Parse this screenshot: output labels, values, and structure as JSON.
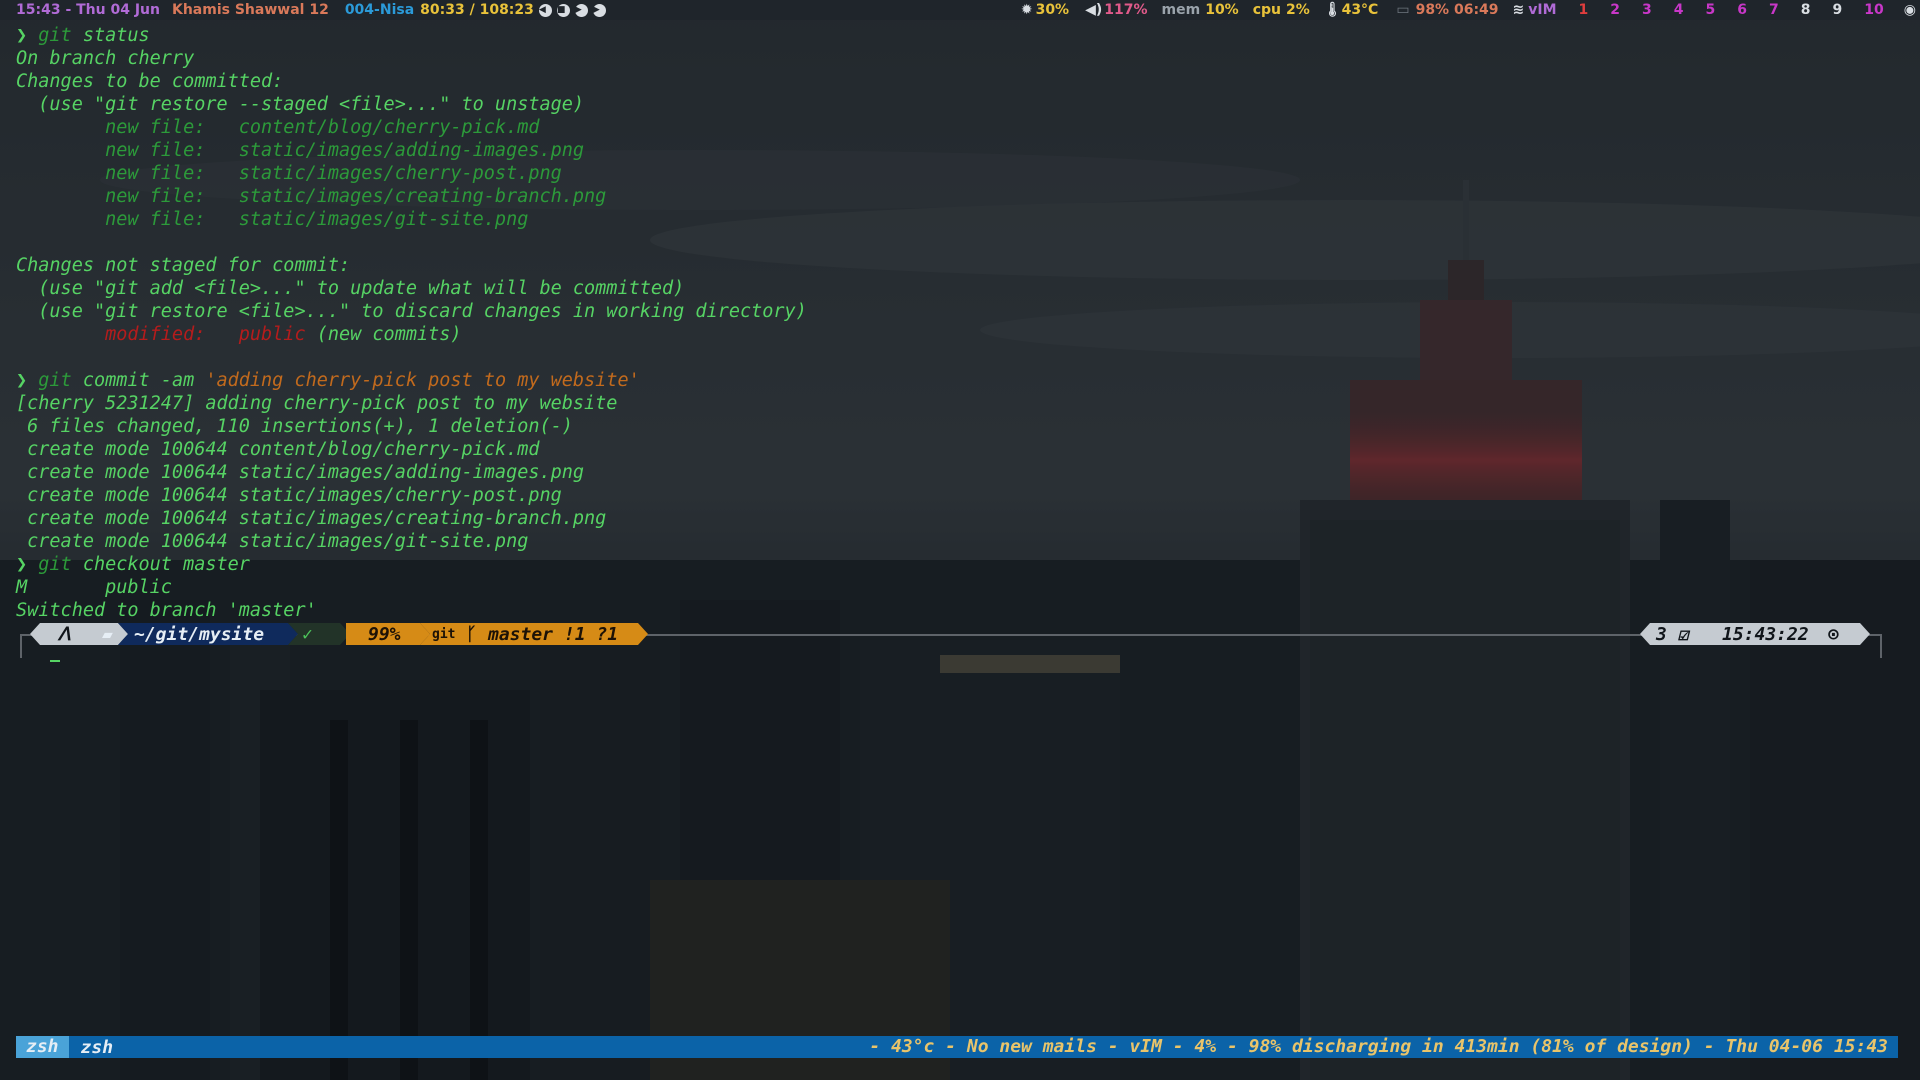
{
  "topbar": {
    "clock": "15:43 - Thu 04 Jun",
    "hijri": "Khamis Shawwal 12",
    "track": "004-Nisa",
    "progress": "80:33 / 108:23",
    "brightness": "30%",
    "volume": "117%",
    "mem_label": "mem",
    "mem_value": "10%",
    "cpu_label": "cpu",
    "cpu_value": "2%",
    "temp": "43°C",
    "battery": "98% 06:49",
    "wifi": "vIM",
    "workspaces": [
      "1",
      "2",
      "3",
      "4",
      "5",
      "6",
      "7",
      "8",
      "9",
      "10"
    ],
    "workspace_colors": [
      "#e03d3d",
      "#c837c8",
      "#c837c8",
      "#c837c8",
      "#c837c8",
      "#c837c8",
      "#c837c8",
      "#d8dde2",
      "#d8dde2",
      "#c837c8"
    ]
  },
  "terminal": {
    "prompt_symbol": "❯",
    "lines": [
      {
        "parts": [
          {
            "t": "❯ ",
            "c": "sym"
          },
          {
            "t": "git",
            "c": "dim"
          },
          {
            "t": " status",
            "c": ""
          }
        ]
      },
      {
        "parts": [
          {
            "t": "On branch cherry",
            "c": ""
          }
        ]
      },
      {
        "parts": [
          {
            "t": "Changes to be committed:",
            "c": ""
          }
        ]
      },
      {
        "parts": [
          {
            "t": "  (use \"git restore --staged <file>...\" to unstage)",
            "c": ""
          }
        ]
      },
      {
        "parts": [
          {
            "t": "        new file:   content/blog/cherry-pick.md",
            "c": "dim"
          }
        ]
      },
      {
        "parts": [
          {
            "t": "        new file:   static/images/adding-images.png",
            "c": "dim"
          }
        ]
      },
      {
        "parts": [
          {
            "t": "        new file:   static/images/cherry-post.png",
            "c": "dim"
          }
        ]
      },
      {
        "parts": [
          {
            "t": "        new file:   static/images/creating-branch.png",
            "c": "dim"
          }
        ]
      },
      {
        "parts": [
          {
            "t": "        new file:   static/images/git-site.png",
            "c": "dim"
          }
        ]
      },
      {
        "parts": [
          {
            "t": "",
            "c": ""
          }
        ]
      },
      {
        "parts": [
          {
            "t": "Changes not staged for commit:",
            "c": ""
          }
        ]
      },
      {
        "parts": [
          {
            "t": "  (use \"git add <file>...\" to update what will be committed)",
            "c": ""
          }
        ]
      },
      {
        "parts": [
          {
            "t": "  (use \"git restore <file>...\" to discard changes in working directory)",
            "c": ""
          }
        ]
      },
      {
        "parts": [
          {
            "t": "        modified:   public",
            "c": "red"
          },
          {
            "t": " (new commits)",
            "c": ""
          }
        ]
      },
      {
        "parts": [
          {
            "t": "",
            "c": ""
          }
        ]
      },
      {
        "parts": [
          {
            "t": "❯ ",
            "c": "sym"
          },
          {
            "t": "git",
            "c": "dim"
          },
          {
            "t": " commit -am ",
            "c": ""
          },
          {
            "t": "'adding cherry-pick post to my website'",
            "c": "orange"
          }
        ]
      },
      {
        "parts": [
          {
            "t": "[cherry 5231247] adding cherry-pick post to my website",
            "c": ""
          }
        ]
      },
      {
        "parts": [
          {
            "t": " 6 files changed, 110 insertions(+), 1 deletion(-)",
            "c": ""
          }
        ]
      },
      {
        "parts": [
          {
            "t": " create mode 100644 content/blog/cherry-pick.md",
            "c": ""
          }
        ]
      },
      {
        "parts": [
          {
            "t": " create mode 100644 static/images/adding-images.png",
            "c": ""
          }
        ]
      },
      {
        "parts": [
          {
            "t": " create mode 100644 static/images/cherry-post.png",
            "c": ""
          }
        ]
      },
      {
        "parts": [
          {
            "t": " create mode 100644 static/images/creating-branch.png",
            "c": ""
          }
        ]
      },
      {
        "parts": [
          {
            "t": " create mode 100644 static/images/git-site.png",
            "c": ""
          }
        ]
      },
      {
        "parts": [
          {
            "t": "❯ ",
            "c": "sym"
          },
          {
            "t": "git",
            "c": "dim"
          },
          {
            "t": " checkout master",
            "c": ""
          }
        ]
      },
      {
        "parts": [
          {
            "t": "M       public",
            "c": ""
          }
        ]
      },
      {
        "parts": [
          {
            "t": "Switched to branch 'master'",
            "c": ""
          }
        ]
      }
    ]
  },
  "prompt": {
    "os_glyph": "ᐱ",
    "dir": "~/git/mysite",
    "status_ok": "✓",
    "battery": "99%",
    "git_label": "git",
    "branch": "master !1 ?1",
    "jobs": "3 ☑",
    "time": "15:43:22"
  },
  "statusbar": {
    "active_window": "zsh",
    "window": "zsh",
    "right": "- 43°c - No new mails - vIM - 4% - 98% discharging in 413min (81% of design) - Thu 04-06 15:43"
  }
}
